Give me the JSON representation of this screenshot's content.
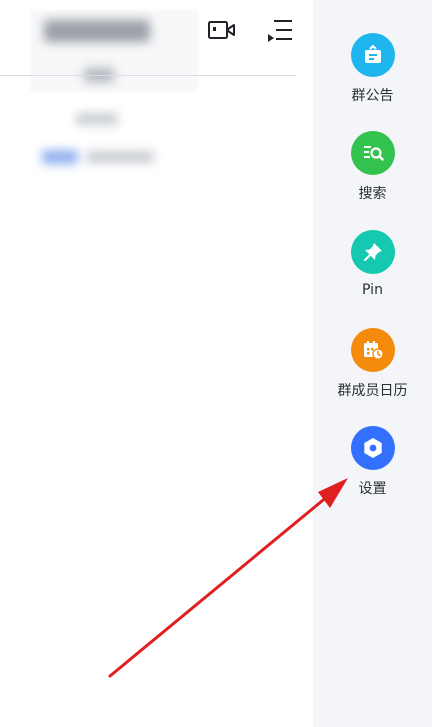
{
  "side_panel": {
    "items": [
      {
        "label": "群公告",
        "icon": "announcement-icon",
        "color": "#1fb6f0"
      },
      {
        "label": "搜索",
        "icon": "search-icon",
        "color": "#33c24d"
      },
      {
        "label": "Pin",
        "icon": "pin-icon",
        "color": "#15c9b0"
      },
      {
        "label": "群成员日历",
        "icon": "calendar-icon",
        "color": "#f58b0c"
      },
      {
        "label": "设置",
        "icon": "settings-icon",
        "color": "#3370ff"
      }
    ]
  },
  "header": {
    "icons": [
      "video-call-icon",
      "menu-list-icon"
    ]
  },
  "annotation": {
    "arrow_color": "#e02020"
  }
}
